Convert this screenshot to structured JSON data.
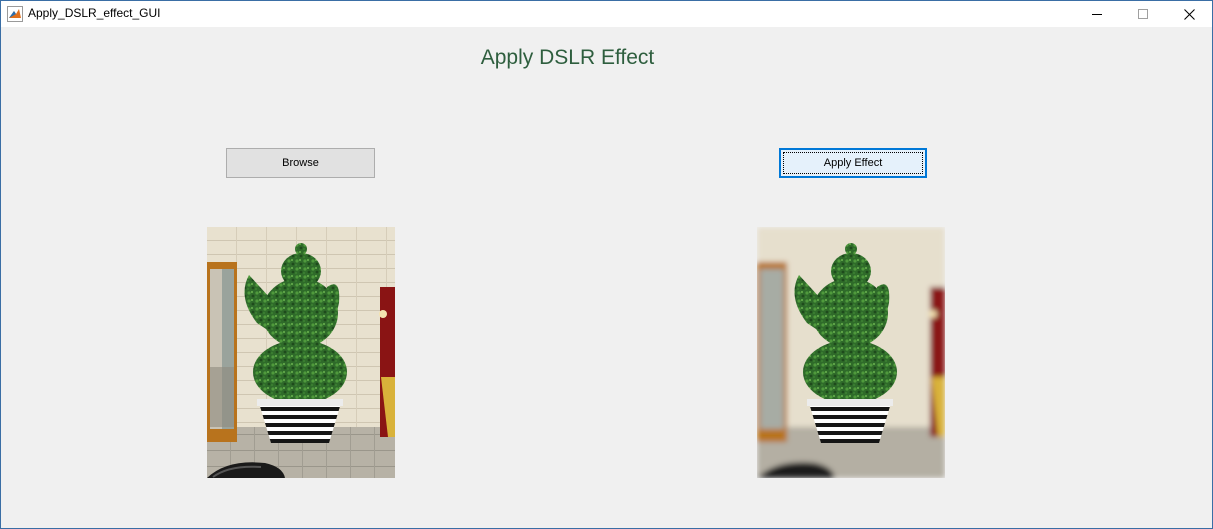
{
  "window": {
    "title": "Apply_DSLR_effect_GUI",
    "app_icon": "matlab-icon",
    "controls": [
      "minimize-icon",
      "maximize-icon",
      "close-icon"
    ]
  },
  "main": {
    "heading": "Apply DSLR Effect",
    "heading_color": "#2e5e3e",
    "browse_label": "Browse",
    "apply_label": "Apply Effect",
    "original_image": "topiary teapot photo",
    "result_image": "topiary teapot photo with DSLR blur effect"
  },
  "colors": {
    "background": "#f0f0f0",
    "button_face": "#e1e1e1",
    "focused_button_face": "#e5f1fb",
    "focus_border": "#0078d7"
  }
}
